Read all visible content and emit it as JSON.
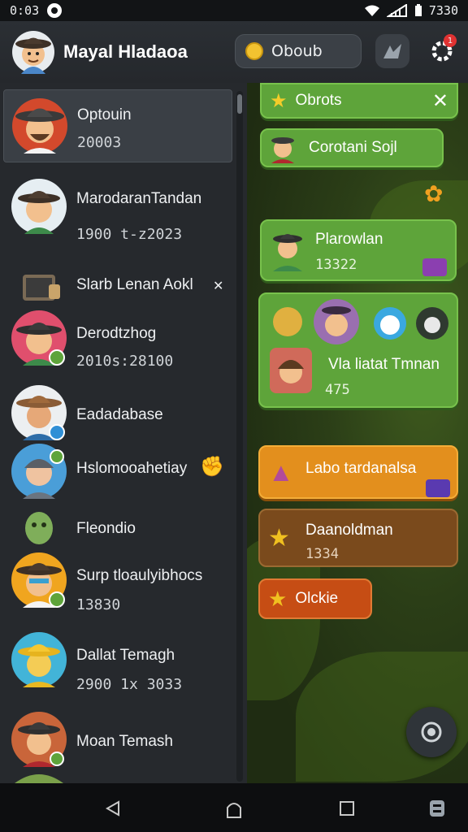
{
  "status_bar": {
    "time": "0:03",
    "battery_time": "7330"
  },
  "header": {
    "title": "Mayal Hladaoa",
    "coins_label": "Oboub",
    "notification_count": "1"
  },
  "contacts": [
    {
      "name": "Optouin",
      "sub": "20003",
      "selected": true
    },
    {
      "name": "MarodaranTandan",
      "sub": "1900 t-z2023"
    },
    {
      "name": "Slarb Lenan Aokl",
      "sub": ""
    },
    {
      "name": "Derodtzhog",
      "sub": "2010s:28100"
    },
    {
      "name": "Eadadabase",
      "sub": ""
    },
    {
      "name": "Hslomooahetiay",
      "sub": ""
    },
    {
      "name": "Fleondio",
      "sub": ""
    },
    {
      "name": "Surp tloaulyibhocs",
      "sub": "13830"
    },
    {
      "name": "Dallat Temagh",
      "sub": "2900 1x 3033"
    },
    {
      "name": "Moan Temash",
      "sub": ""
    }
  ],
  "chat": {
    "banner": {
      "label": "Obrots"
    },
    "bubbles": [
      {
        "text": "Corotani Sojl"
      },
      {
        "text": "Plarowlan",
        "sub": "13322"
      },
      {
        "text": "Vla liatat Tmnan",
        "sub": "475"
      },
      {
        "text": "Labo tardanalsa"
      },
      {
        "text": "Daanoldman",
        "sub": "1334"
      },
      {
        "text": "Olckie"
      }
    ]
  },
  "colors": {
    "accent_green": "#5ea43a",
    "accent_orange": "#e38f1d",
    "panel": "#26292d",
    "badge_red": "#e03232"
  }
}
